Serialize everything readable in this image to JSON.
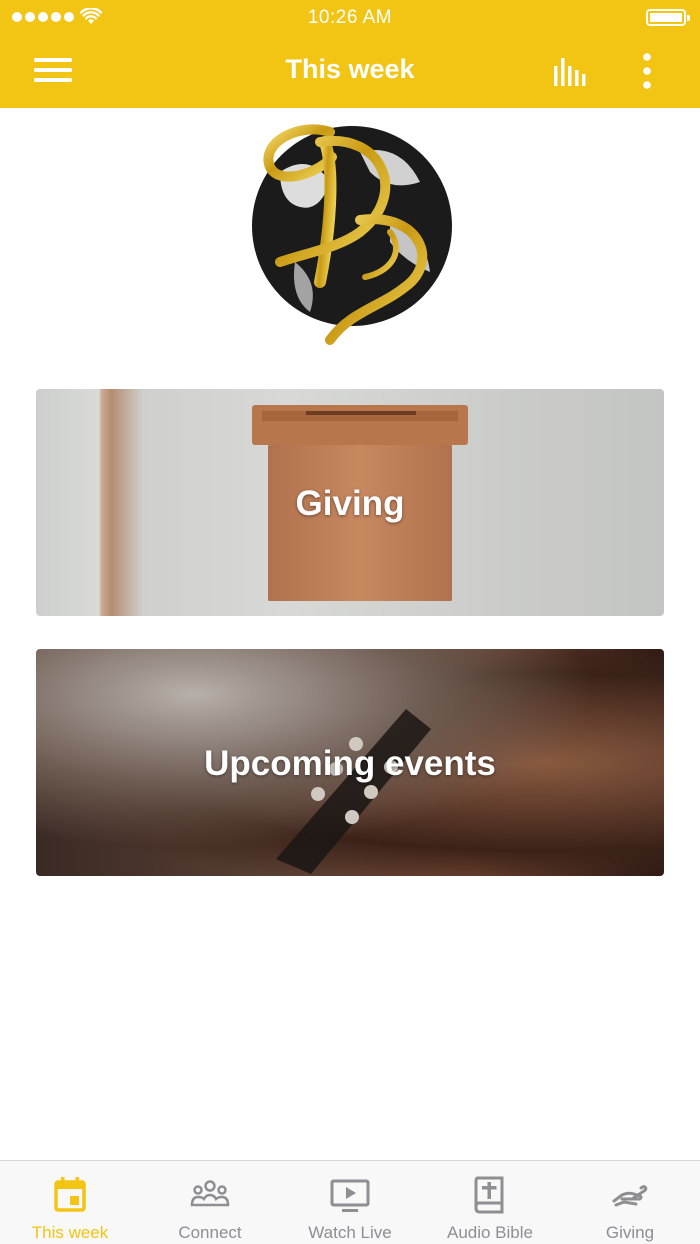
{
  "status_bar": {
    "time": "10:26 AM"
  },
  "header": {
    "title": "This week",
    "background_color": "#F2C413",
    "icons": [
      "hamburger-menu-icon",
      "bar-chart-icon",
      "more-vertical-icon"
    ]
  },
  "cards": [
    {
      "label": "Giving"
    },
    {
      "label": "Upcoming events"
    }
  ],
  "tabbar": {
    "active_color": "#F2C413",
    "inactive_color": "#8e8e93",
    "active_index": 0,
    "tabs": [
      {
        "label": "This week",
        "icon": "calendar-icon"
      },
      {
        "label": "Connect",
        "icon": "group-icon"
      },
      {
        "label": "Watch Live",
        "icon": "tv-play-icon"
      },
      {
        "label": "Audio Bible",
        "icon": "bible-icon"
      },
      {
        "label": "Giving",
        "icon": "giving-hand-icon"
      }
    ]
  }
}
